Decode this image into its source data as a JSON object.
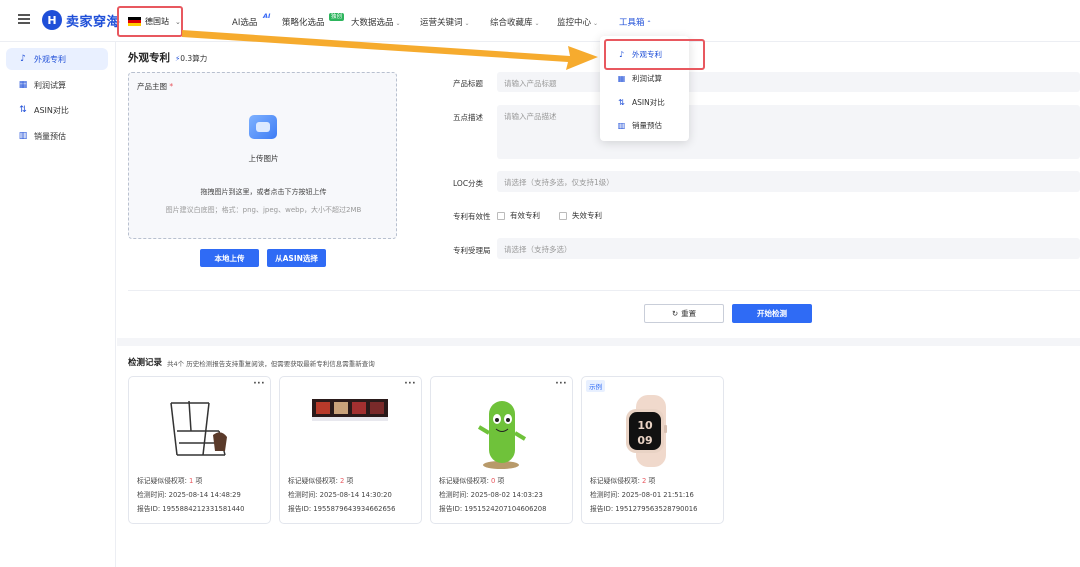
{
  "app": {
    "logo_text": "卖家穿海",
    "logo_mark": "H"
  },
  "header": {
    "site_label": "德国站",
    "flag_colors": [
      "#000000",
      "#dd0000",
      "#ffce00"
    ],
    "nav": [
      {
        "label": "AI选品",
        "has_caret": false
      },
      {
        "label": "策略化选品",
        "has_caret": false
      },
      {
        "label": "大数据选品",
        "has_caret": true
      },
      {
        "label": "运营关键词",
        "has_caret": true
      },
      {
        "label": "综合收藏库",
        "has_caret": true
      },
      {
        "label": "监控中心",
        "has_caret": true
      },
      {
        "label": "工具箱",
        "has_caret": true,
        "active": true
      }
    ],
    "ai_badge": "AI",
    "new_badge": "独创"
  },
  "sidebar": {
    "items": [
      {
        "label": "外观专利",
        "icon": "patent-icon",
        "active": true
      },
      {
        "label": "利润试算",
        "icon": "calculator-icon",
        "active": false
      },
      {
        "label": "ASIN对比",
        "icon": "compare-icon",
        "active": false
      },
      {
        "label": "销量预估",
        "icon": "sales-chart-icon",
        "active": false
      }
    ]
  },
  "page": {
    "title": "外观专利",
    "cost": "0.3算力"
  },
  "upload": {
    "label": "产品主图",
    "required_mark": "*",
    "main_text": "上传图片",
    "hint1": "拖拽图片到这里，或者点击下方按钮上传",
    "hint2": "图片建议白底图；格式：png、jpeg、webp，大小不超过2MB",
    "btn_local": "本地上传",
    "btn_asin": "从ASIN选择"
  },
  "form": {
    "title_label": "产品标题",
    "title_placeholder": "请输入产品标题",
    "bullets_label": "五点描述",
    "bullets_placeholder": "请输入产品描述",
    "loc_label": "LOC分类",
    "loc_placeholder": "请选择（支持多选，仅支持1级）",
    "validity_label": "专利有效性",
    "valid_option": "有效专利",
    "invalid_option": "失效专利",
    "office_label": "专利受理局",
    "office_placeholder": "请选择（支持多选）"
  },
  "actions": {
    "reset": "重置",
    "start": "开始检测"
  },
  "records": {
    "title": "检测记录",
    "subtitle": "共4个 历史检测报告支持重复阅读，但需要获取最新专利信息需重新查询",
    "sample_label": "示例",
    "items": [
      {
        "risk_label": "标记疑似侵权项: ",
        "risk_count": "1",
        "unit": " 项",
        "time_label": "检测时间: ",
        "time": "2025-08-14 14:48:29",
        "id_label": "报告ID: ",
        "id": "1955884212331581440",
        "image": "rack-image",
        "sample": false
      },
      {
        "risk_label": "标记疑似侵权项: ",
        "risk_count": "2",
        "unit": " 项",
        "time_label": "检测时间: ",
        "time": "2025-08-14 14:30:20",
        "id_label": "报告ID: ",
        "id": "1955879643934662656",
        "image": "banner-image",
        "sample": false
      },
      {
        "risk_label": "标记疑似侵权项: ",
        "risk_count": "0",
        "unit": " 项",
        "time_label": "检测时间: ",
        "time": "2025-08-02 14:03:23",
        "id_label": "报告ID: ",
        "id": "1951524207104606208",
        "image": "plush-image",
        "sample": false
      },
      {
        "risk_label": "标记疑似侵权项: ",
        "risk_count": "2",
        "unit": " 项",
        "time_label": "检测时间: ",
        "time": "2025-08-01 21:51:16",
        "id_label": "报告ID: ",
        "id": "1951279563528790016",
        "image": "watch-image",
        "sample": true
      }
    ]
  },
  "tools_menu": {
    "items": [
      {
        "label": "外观专利",
        "icon": "patent-icon",
        "active": true
      },
      {
        "label": "利润试算",
        "icon": "calculator-icon",
        "active": false
      },
      {
        "label": "ASIN对比",
        "icon": "compare-icon",
        "active": false
      },
      {
        "label": "销量预估",
        "icon": "sales-chart-icon",
        "active": false
      }
    ]
  },
  "colors": {
    "accent": "#2f6bf5",
    "highlight": "#e8585f",
    "arrow": "#f5a623"
  }
}
